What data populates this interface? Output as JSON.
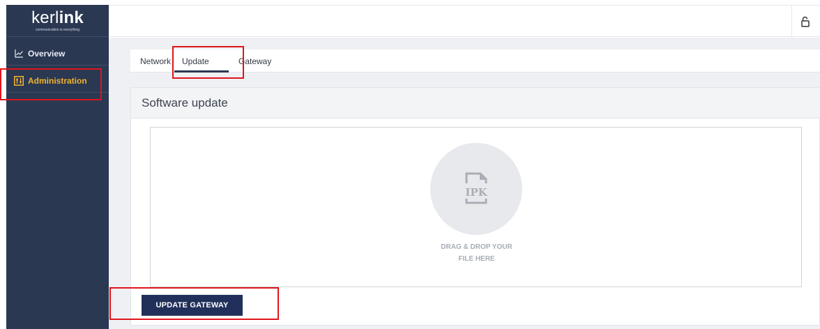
{
  "brand": {
    "logo_prefix": "kerl",
    "logo_suffix": "ink",
    "tagline": "communication is everything"
  },
  "sidebar": {
    "items": [
      {
        "label": "Overview",
        "icon": "chart-line-icon"
      },
      {
        "label": "Administration",
        "icon": "admin-panel-icon",
        "active": true
      }
    ]
  },
  "topbar": {
    "icon": "lock-open-icon"
  },
  "tabs": [
    {
      "label": "Network"
    },
    {
      "label": "Update",
      "active": true
    },
    {
      "label": "Gateway"
    }
  ],
  "panel": {
    "title": "Software update",
    "dropzone": {
      "file_label": "IPK",
      "line1": "DRAG & DROP YOUR",
      "line2": "FILE HERE"
    },
    "button_label": "UPDATE GATEWAY"
  },
  "colors": {
    "sidebar_bg": "#2b3852",
    "active_accent": "#f0b32d",
    "button_bg": "#21305a",
    "highlight": "#e0141a"
  }
}
